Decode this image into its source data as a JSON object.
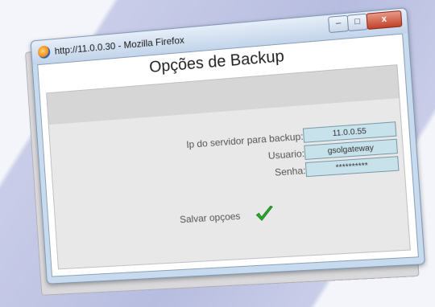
{
  "window": {
    "title": "http://11.0.0.30 - Mozilla Firefox",
    "controls": {
      "minimize": "–",
      "maximize": "□",
      "close": "x"
    }
  },
  "page": {
    "heading": "Opções de Backup"
  },
  "form": {
    "server_ip": {
      "label": "Ip do servidor para backup:",
      "value": "11.0.0.55"
    },
    "user": {
      "label": "Usuario:",
      "value": "gsolgateway"
    },
    "password": {
      "label": "Senha:",
      "value": "**********"
    },
    "save_label": "Salvar opçoes"
  },
  "colors": {
    "field_bg": "#c8e2ec",
    "check_green": "#2db12d"
  }
}
